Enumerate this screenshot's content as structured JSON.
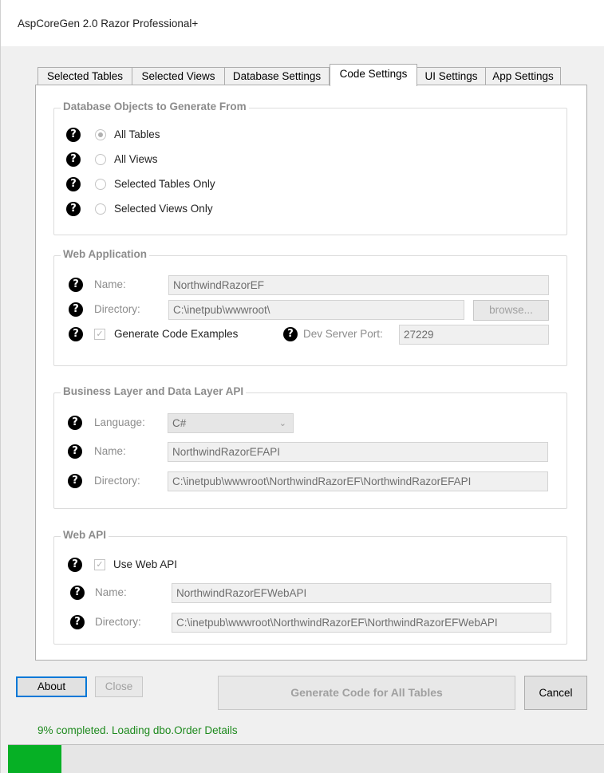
{
  "window": {
    "title": "AspCoreGen 2.0 Razor Professional+"
  },
  "tabs": [
    {
      "label": "Selected Tables"
    },
    {
      "label": "Selected Views"
    },
    {
      "label": "Database Settings"
    },
    {
      "label": "Code Settings"
    },
    {
      "label": "UI Settings"
    },
    {
      "label": "App Settings"
    }
  ],
  "active_tab": "Code Settings",
  "db_objects": {
    "title": "Database Objects to Generate From",
    "options": [
      {
        "label": "All Tables",
        "selected": true
      },
      {
        "label": "All Views",
        "selected": false
      },
      {
        "label": "Selected Tables Only",
        "selected": false
      },
      {
        "label": "Selected Views Only",
        "selected": false
      }
    ]
  },
  "web_app": {
    "title": "Web Application",
    "name_label": "Name:",
    "name_value": "NorthwindRazorEF",
    "dir_label": "Directory:",
    "dir_value": "C:\\inetpub\\wwwroot\\",
    "browse_label": "browse...",
    "gen_examples_label": "Generate Code Examples",
    "gen_examples_checked": true,
    "port_label": "Dev Server Port:",
    "port_value": "27229"
  },
  "business_layer": {
    "title": "Business Layer and Data Layer API",
    "language_label": "Language:",
    "language_value": "C#",
    "name_label": "Name:",
    "name_value": "NorthwindRazorEFAPI",
    "dir_label": "Directory:",
    "dir_value": "C:\\inetpub\\wwwroot\\NorthwindRazorEF\\NorthwindRazorEFAPI"
  },
  "web_api": {
    "title": "Web API",
    "use_label": "Use Web API",
    "use_checked": true,
    "name_label": "Name:",
    "name_value": "NorthwindRazorEFWebAPI",
    "dir_label": "Directory:",
    "dir_value": "C:\\inetpub\\wwwroot\\NorthwindRazorEF\\NorthwindRazorEFWebAPI"
  },
  "help_glyph": "?",
  "check_glyph": "✓",
  "buttons": {
    "about": "About",
    "close": "Close",
    "generate": "Generate Code for All Tables",
    "cancel": "Cancel"
  },
  "status": {
    "text": "9% completed.  Loading dbo.Order Details",
    "progress_percent": 9,
    "color": "#06b025"
  }
}
